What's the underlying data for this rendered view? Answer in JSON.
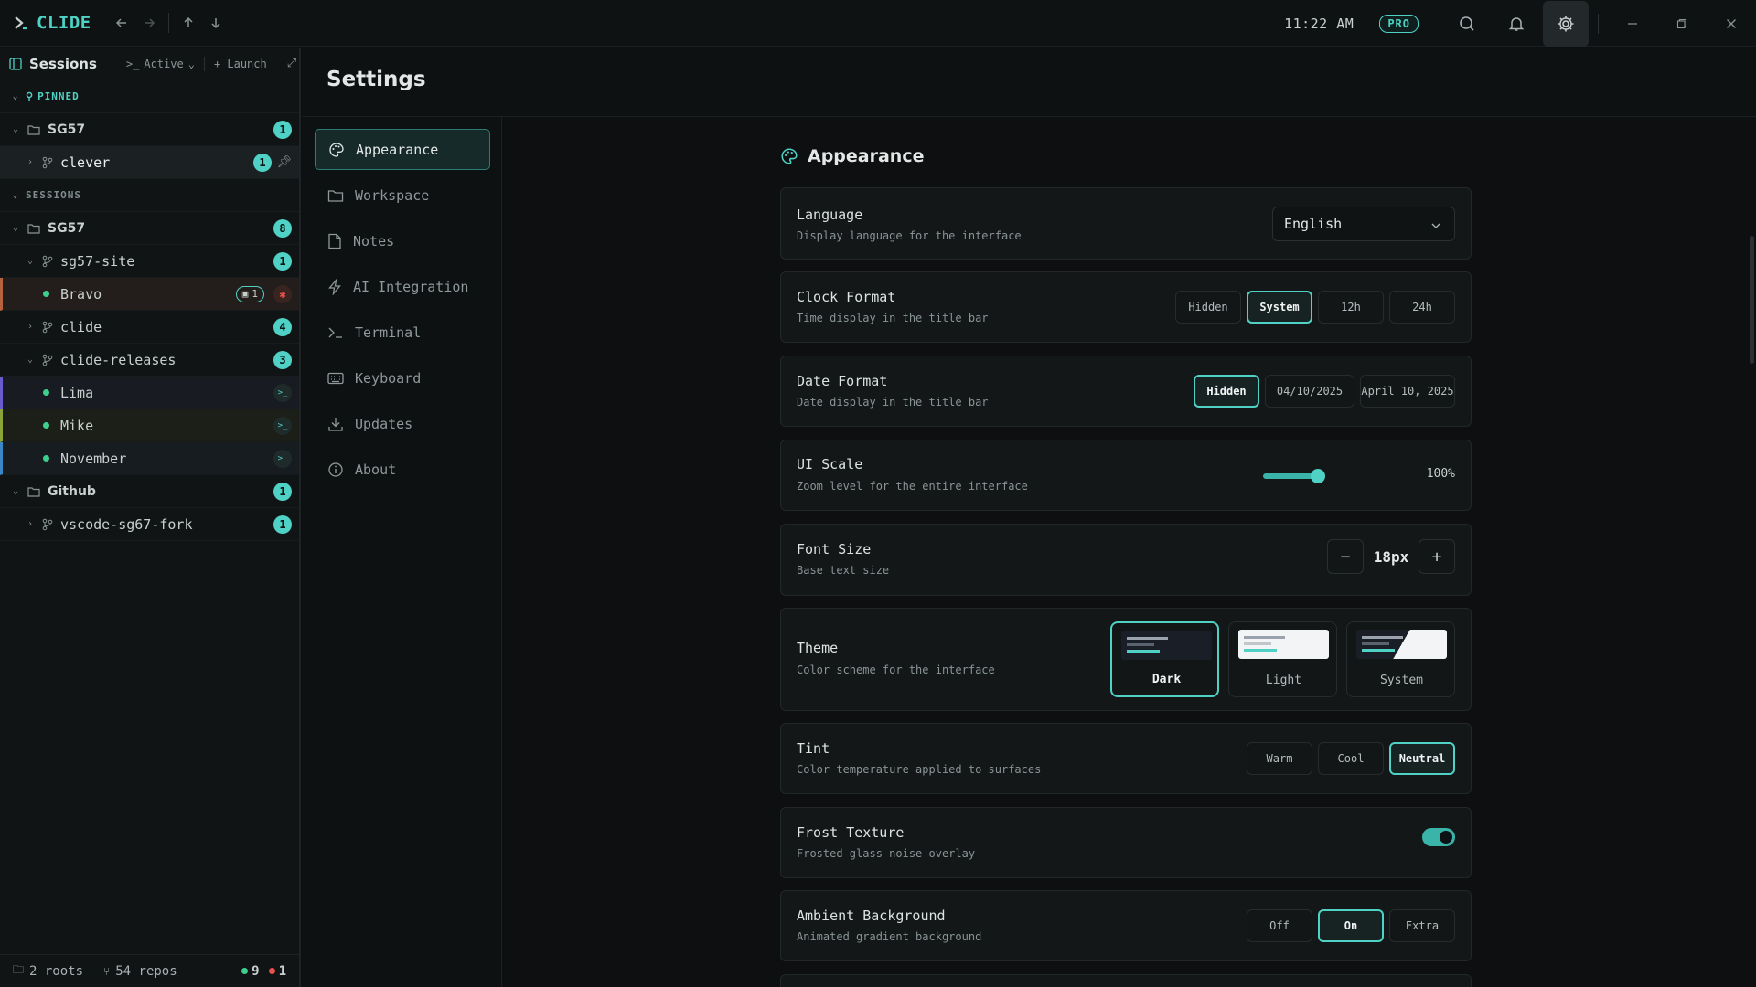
{
  "app": {
    "name": "CLIDE",
    "clock": "11:22 AM",
    "pro_badge": "PRO"
  },
  "sidebar": {
    "title": "Sessions",
    "filter": "Active",
    "launch": "+ Launch",
    "pinned_label": "PINNED",
    "sessions_label": "SESSIONS",
    "pinned": [
      {
        "label": "SG57",
        "badge": "1"
      },
      {
        "label": "clever",
        "badge": "1"
      }
    ],
    "groups": [
      {
        "label": "SG57",
        "badge": "8"
      },
      {
        "label": "sg57-site",
        "badge": "1"
      },
      {
        "label": "Bravo",
        "badge": "1"
      },
      {
        "label": "clide",
        "badge": "4"
      },
      {
        "label": "clide-releases",
        "badge": "3"
      },
      {
        "label": "Lima"
      },
      {
        "label": "Mike"
      },
      {
        "label": "November"
      },
      {
        "label": "Github",
        "badge": "1"
      },
      {
        "label": "vscode-sg67-fork",
        "badge": "1"
      }
    ],
    "footer": {
      "roots": "2 roots",
      "repos": "54 repos",
      "green_count": "9",
      "red_count": "1"
    }
  },
  "settings": {
    "title": "Settings",
    "nav": [
      "Appearance",
      "Workspace",
      "Notes",
      "AI Integration",
      "Terminal",
      "Keyboard",
      "Updates",
      "About"
    ],
    "section_title": "Appearance",
    "language": {
      "title": "Language",
      "desc": "Display language for the interface",
      "value": "English"
    },
    "clock_format": {
      "title": "Clock Format",
      "desc": "Time display in the title bar",
      "options": [
        "Hidden",
        "System",
        "12h",
        "24h"
      ],
      "selected": "System"
    },
    "date_format": {
      "title": "Date Format",
      "desc": "Date display in the title bar",
      "options": [
        "Hidden",
        "04/10/2025",
        "April 10, 2025"
      ],
      "selected": "Hidden"
    },
    "ui_scale": {
      "title": "UI Scale",
      "desc": "Zoom level for the entire interface",
      "value": "100%"
    },
    "font_size": {
      "title": "Font Size",
      "desc": "Base text size",
      "value": "18px",
      "minus": "−",
      "plus": "+"
    },
    "theme": {
      "title": "Theme",
      "desc": "Color scheme for the interface",
      "options": [
        "Dark",
        "Light",
        "System"
      ],
      "selected": "Dark"
    },
    "tint": {
      "title": "Tint",
      "desc": "Color temperature applied to surfaces",
      "options": [
        "Warm",
        "Cool",
        "Neutral"
      ],
      "selected": "Neutral"
    },
    "frost": {
      "title": "Frost Texture",
      "desc": "Frosted glass noise overlay",
      "enabled": true
    },
    "ambient": {
      "title": "Ambient Background",
      "desc": "Animated gradient background",
      "options": [
        "Off",
        "On",
        "Extra"
      ],
      "selected": "On"
    }
  },
  "colors": {
    "accent": "#4fd1c5",
    "background": "#0d0f10",
    "error": "#e5534b",
    "online": "#3ecf8e"
  }
}
